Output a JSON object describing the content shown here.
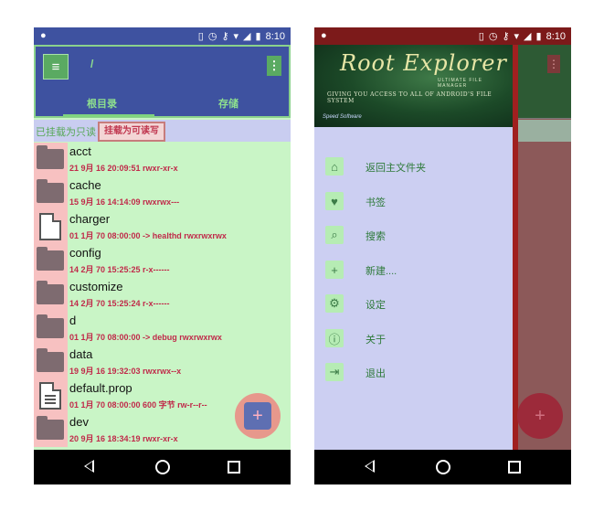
{
  "left_phone": {
    "status": {
      "time": "8:10"
    },
    "appbar": {
      "path": "/",
      "tabs": [
        "根目录",
        "存储"
      ]
    },
    "mount": {
      "status": "已挂载为只读",
      "button": "挂载为可读写"
    },
    "files": [
      {
        "name": "acct",
        "type": "folder",
        "meta": "21 9月 16 20:09:51   rwxr-xr-x"
      },
      {
        "name": "cache",
        "type": "folder",
        "meta": "15 9月 16 14:14:09   rwxrwx---"
      },
      {
        "name": "charger",
        "type": "file",
        "meta": "01 1月 70 08:00:00  -> healthd  rwxrwxrwx"
      },
      {
        "name": "config",
        "type": "folder",
        "meta": "14 2月 70 15:25:25   r-x------"
      },
      {
        "name": "customize",
        "type": "folder",
        "meta": "14 2月 70 15:25:24   r-x------"
      },
      {
        "name": "d",
        "type": "folder",
        "meta": "01 1月 70 08:00:00  -> debug  rwxrwxrwx"
      },
      {
        "name": "data",
        "type": "folder",
        "meta": "19 9月 16 19:32:03   rwxrwx--x"
      },
      {
        "name": "default.prop",
        "type": "doc",
        "meta": "01 1月 70 08:00:00  600 字节  rw-r--r--"
      },
      {
        "name": "dev",
        "type": "folder",
        "meta": "20 9月 16 18:34:19   rwxr-xr-x"
      }
    ],
    "fab_label": "+"
  },
  "right_phone": {
    "status": {
      "time": "8:10"
    },
    "header": {
      "title": "Root Explorer",
      "subtitle": "ULTIMATE FILE MANAGER",
      "tagline": "GIVING YOU ACCESS TO ALL OF ANDROID'S FILE SYSTEM",
      "brand": "Speed Software"
    },
    "menu": [
      {
        "label": "返回主文件夹",
        "icon": "home-icon",
        "glyph": "⌂"
      },
      {
        "label": "书签",
        "icon": "heart-icon",
        "glyph": "♥"
      },
      {
        "label": "搜索",
        "icon": "search-icon",
        "glyph": "⌕"
      },
      {
        "label": "新建....",
        "icon": "plus-icon",
        "glyph": "+"
      },
      {
        "label": "设定",
        "icon": "gear-icon",
        "glyph": "⚙"
      },
      {
        "label": "关于",
        "icon": "info-icon",
        "glyph": "ⓘ"
      },
      {
        "label": "退出",
        "icon": "exit-icon",
        "glyph": "⇥"
      }
    ],
    "fab_label": "+"
  }
}
